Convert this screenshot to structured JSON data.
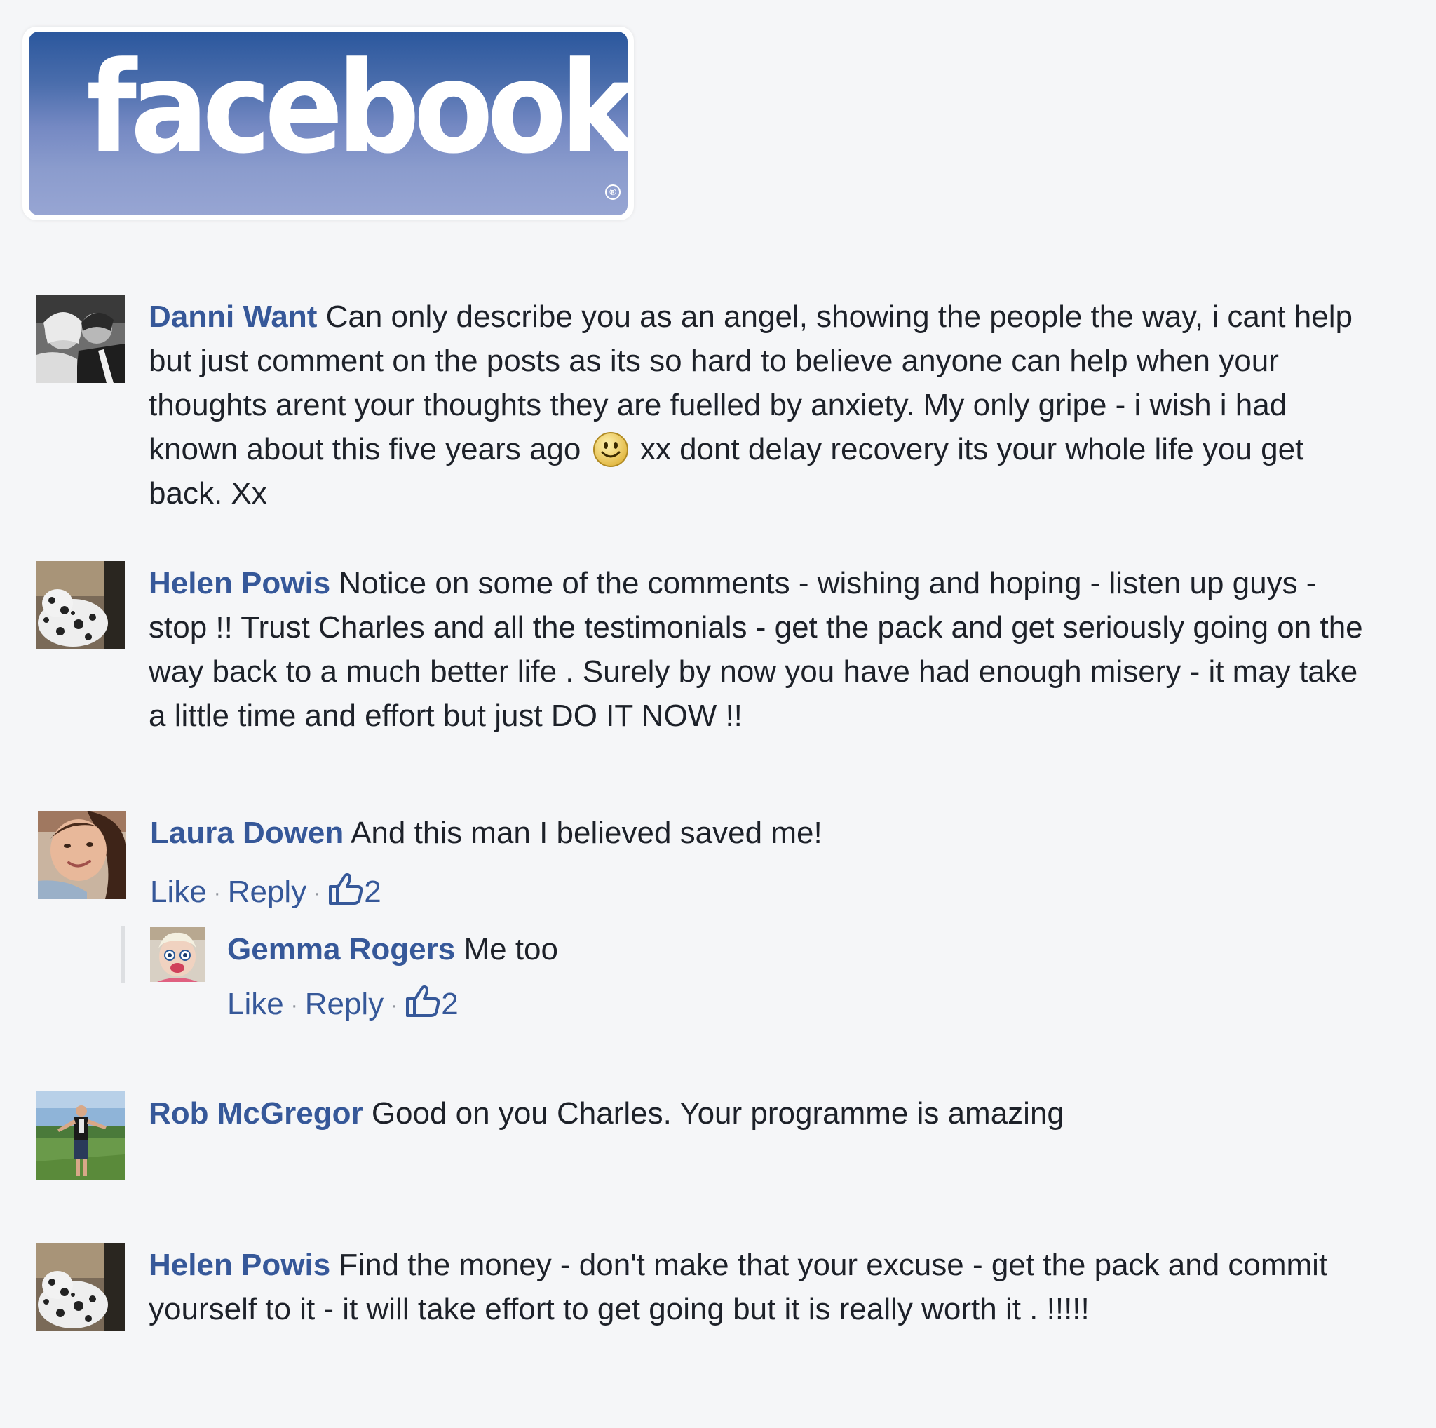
{
  "logo": {
    "wordmark": "facebook",
    "registered": "®"
  },
  "colors": {
    "name_link": "#365899",
    "body_text": "#1d2129",
    "background": "#f5f6f8"
  },
  "comments": [
    {
      "author": "Danni Want",
      "text_before_emoji": "Can only describe you as an angel, showing the people the way, i cant help but just comment on the posts as its so hard to believe anyone can help when your thoughts arent your thoughts they are fuelled by anxiety. My only gripe - i wish i had known about this five years ago",
      "emoji": "smiley-face-icon",
      "text_after_emoji": "xx dont delay recovery its your whole life you get back. Xx"
    },
    {
      "author": "Helen Powis",
      "text": "Notice on some of the comments - wishing and hoping - listen up guys - stop !! Trust Charles and all the testimonials - get the pack and get seriously going on the way back to a much better life . Surely by now you have had enough misery - it may take a little time and effort but just DO IT NOW !!"
    },
    {
      "author": "Laura Dowen",
      "text": "And this man I believed saved me!",
      "like_label": "Like",
      "reply_label": "Reply",
      "separator": "·",
      "like_count": "2",
      "reply": {
        "author": "Gemma Rogers",
        "text": "Me too",
        "like_label": "Like",
        "reply_label": "Reply",
        "separator": "·",
        "like_count": "2"
      }
    },
    {
      "author": "Rob McGregor",
      "text": "Good on you Charles. Your programme is amazing"
    },
    {
      "author": "Helen Powis",
      "text": "Find the money - don't make that your excuse - get the pack and commit yourself to it - it will take effort to get going but it is really worth it . !!!!!"
    }
  ]
}
